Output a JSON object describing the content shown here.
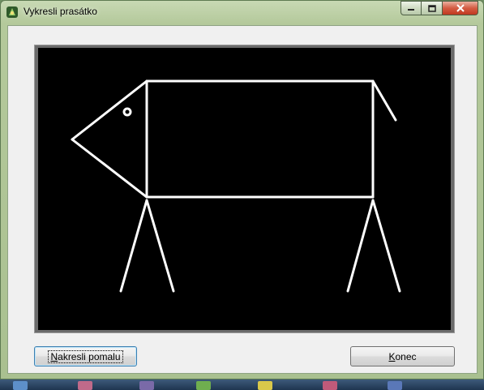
{
  "window": {
    "title": "Vykresli prasátko"
  },
  "canvas": {
    "background": "#000000",
    "stroke": "#ffffff"
  },
  "buttons": {
    "draw_slowly_prefix": "N",
    "draw_slowly_rest": "akresli pomalu",
    "end_prefix": "K",
    "end_rest": "onec"
  },
  "colors": {
    "titlebar": "#b4c99b",
    "client": "#f0f0f0",
    "close_button": "#d45c43"
  },
  "icons": [
    "app-icon",
    "minimize-icon",
    "maximize-icon",
    "close-icon"
  ]
}
